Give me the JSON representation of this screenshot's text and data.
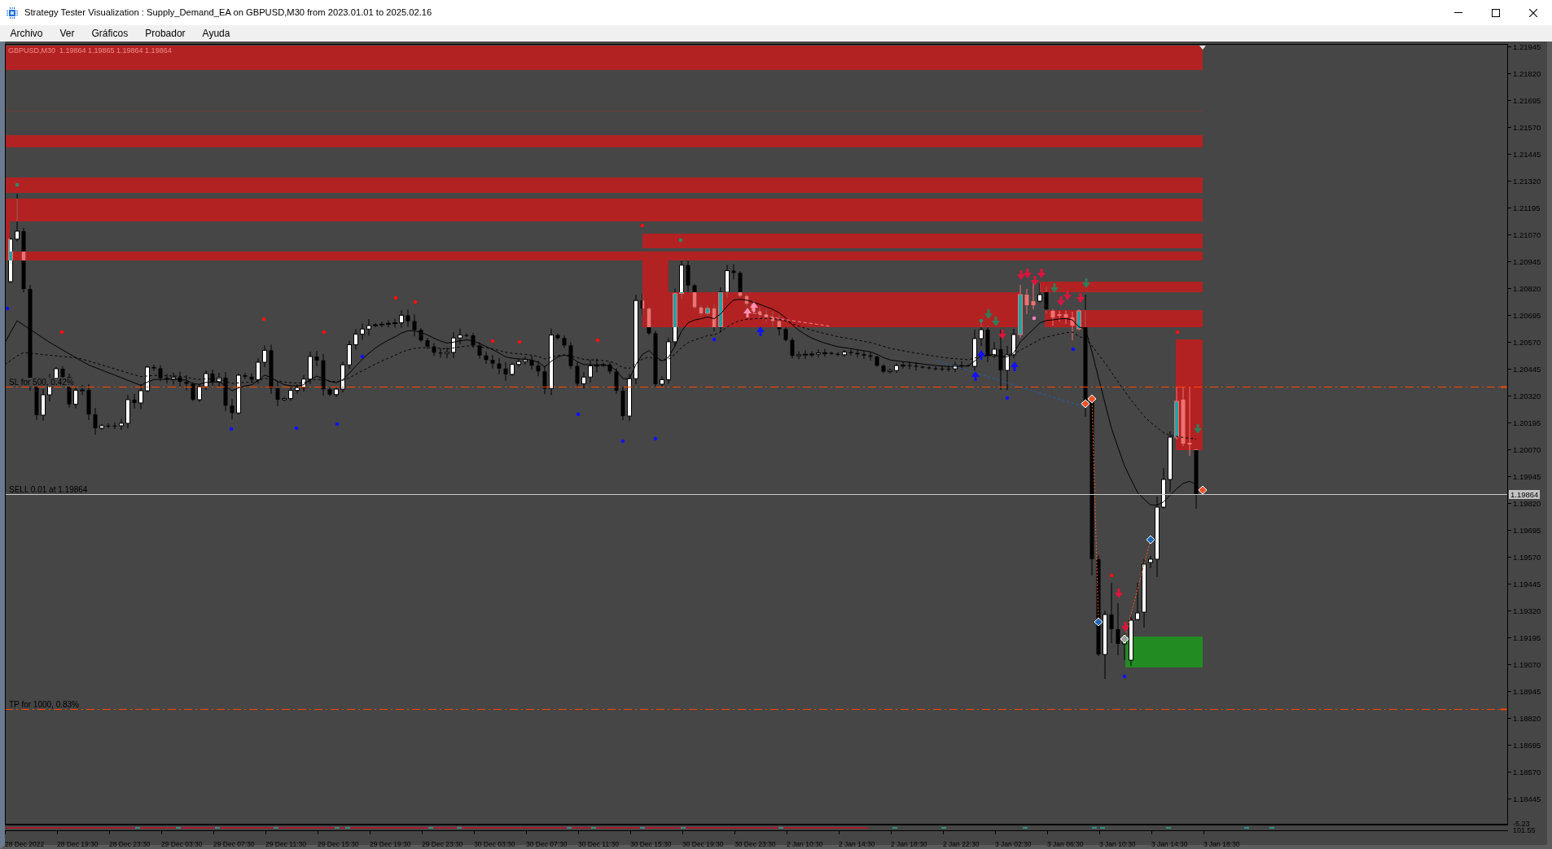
{
  "window": {
    "title": "Strategy Tester Visualization : Supply_Demand_EA on GBPUSD,M30 from 2023.01.01 to 2025.02.16"
  },
  "menu": [
    "Archivo",
    "Ver",
    "Gráficos",
    "Probador",
    "Ayuda"
  ],
  "chart": {
    "legend": "GBPUSD,M30  1.19864 1.19865 1.19864 1.19864",
    "level_lines": [
      {
        "kind": "stop_loss",
        "label": "SL for 500, 0.42%"
      },
      {
        "kind": "position",
        "label": "SELL 0.01 at 1.19864"
      },
      {
        "kind": "take_profit",
        "label": "TP for 1000, 0.83%"
      }
    ],
    "price_axis": {
      "labels": [
        "1.21945",
        "1.21820",
        "1.21695",
        "1.21570",
        "1.21445",
        "1.21320",
        "1.21195",
        "1.21070",
        "1.20945",
        "1.20820",
        "1.20695",
        "1.20570",
        "1.20445",
        "1.20320",
        "1.20195",
        "1.20070",
        "1.19945",
        "1.19820",
        "1.19695",
        "1.19570",
        "1.19445",
        "1.19320",
        "1.19195",
        "1.19070",
        "1.18945",
        "1.18820",
        "1.18695",
        "1.18570",
        "1.18445"
      ],
      "current_price": "1.19864"
    },
    "indicator_axis": {
      "labels": [
        "-5.23",
        "101.55"
      ]
    },
    "time_axis": {
      "labels": [
        "28 Dec 2022",
        "28 Dec 19:30",
        "28 Dec 23:30",
        "29 Dec 03:30",
        "29 Dec 07:30",
        "29 Dec 11:30",
        "29 Dec 15:30",
        "29 Dec 19:30",
        "29 Dec 23:30",
        "30 Dec 03:30",
        "30 Dec 07:30",
        "30 Dec 11:30",
        "30 Dec 15:30",
        "30 Dec 19:30",
        "30 Dec 23:30",
        "2 Jan 10:30",
        "2 Jan 14:30",
        "2 Jan 18:30",
        "2 Jan 22:30",
        "3 Jan 02:30",
        "3 Jan 06:30",
        "3 Jan 10:30",
        "3 Jan 14:30",
        "3 Jan 18:30"
      ]
    }
  }
}
